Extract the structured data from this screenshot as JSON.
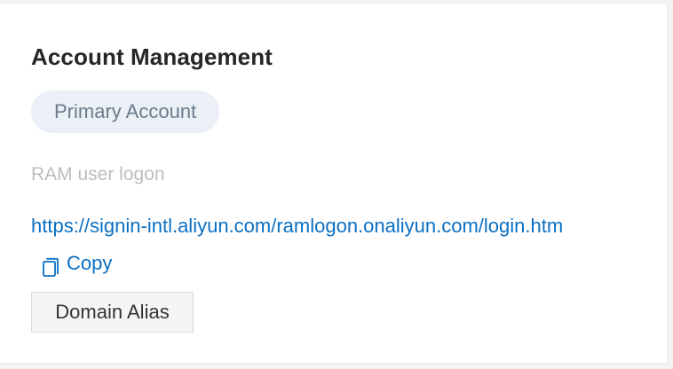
{
  "account_section": {
    "title": "Account Management",
    "account_type_badge": "Primary Account",
    "ram_logon_label": "RAM user logon",
    "ram_logon_url": "https://signin-intl.aliyun.com/ramlogon.onaliyun.com/login.htm",
    "copy_label": "Copy",
    "copy_icon": "copy-icon",
    "domain_alias_button": "Domain Alias"
  },
  "colors": {
    "link": "#0b6fc2",
    "badge_background": "#eaf0f5",
    "badge_text": "#6b7b8c",
    "muted_label": "#bdbdbd",
    "title_text": "#262626"
  }
}
